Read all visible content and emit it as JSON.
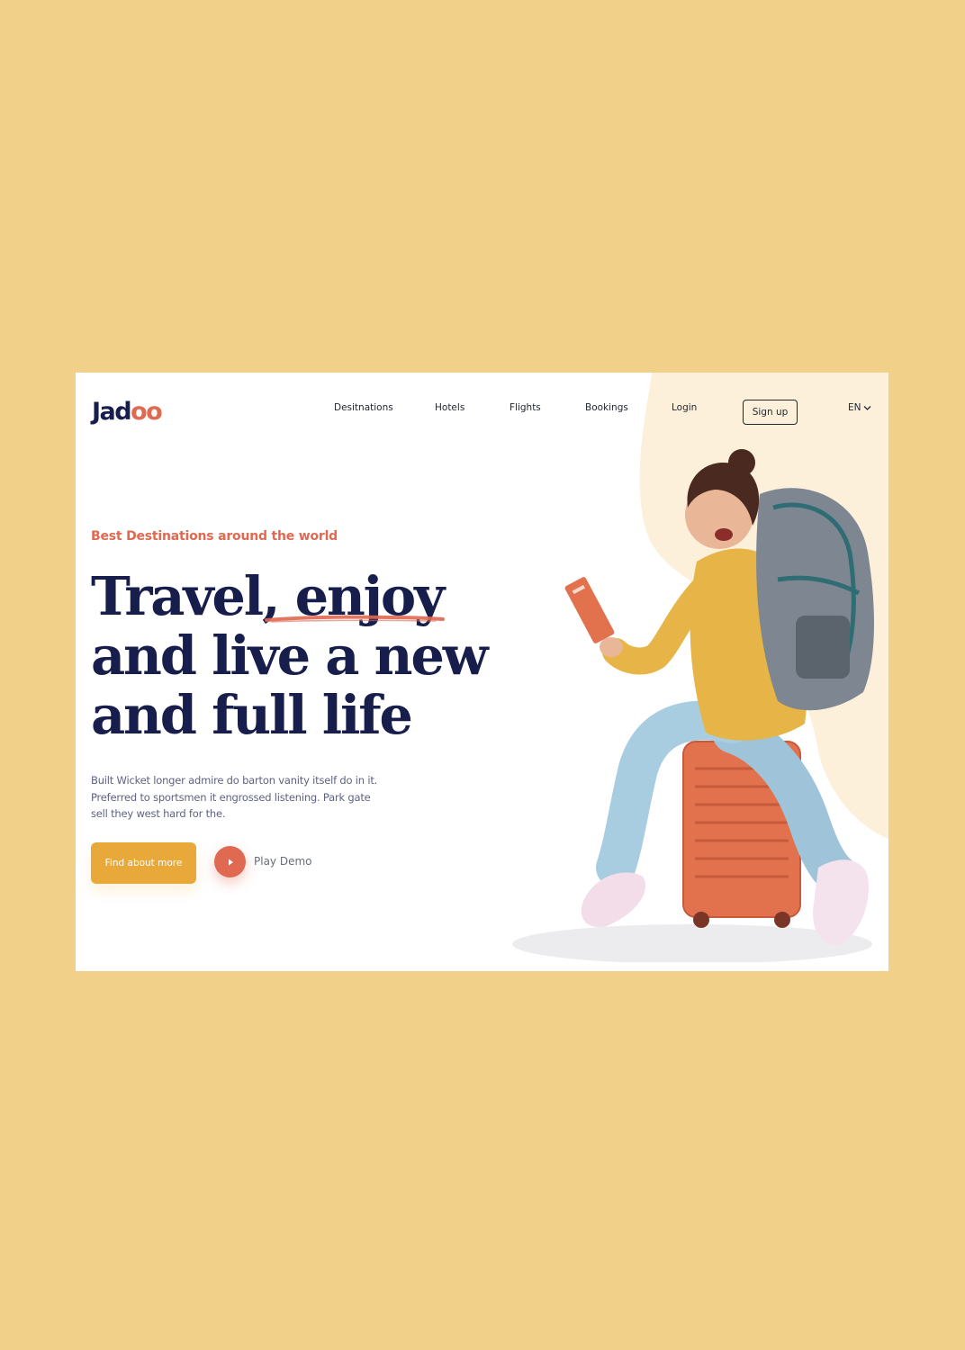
{
  "brand": {
    "logo_text": "Jadoo",
    "logo_main": "Jad",
    "logo_accent": "oo"
  },
  "nav": {
    "items": [
      {
        "label": "Desitnations"
      },
      {
        "label": "Hotels"
      },
      {
        "label": "Flights"
      },
      {
        "label": "Bookings"
      },
      {
        "label": "Login"
      }
    ],
    "signup_label": "Sign up",
    "language": "EN"
  },
  "hero": {
    "tagline": "Best Destinations around the world",
    "headline": {
      "line1": "Travel, enjoy",
      "line2": "and live a new",
      "line3": "and full life"
    },
    "description": "Built Wicket longer admire do barton vanity itself do in it. Preferred to sportsmen it engrossed listening. Park gate sell they west hard for the.",
    "cta_label": "Find about more",
    "play_label": "Play Demo"
  },
  "icons": {
    "play": "play-icon",
    "chevron": "chevron-down-icon",
    "illustration": "traveler-illustration"
  },
  "colors": {
    "page_background": "#F1D08A",
    "navy": "#181E4B",
    "accent": "#DF6951",
    "cta": "#E9A93A",
    "blob": "#FDF0DA",
    "body_text": "#5E6282"
  }
}
